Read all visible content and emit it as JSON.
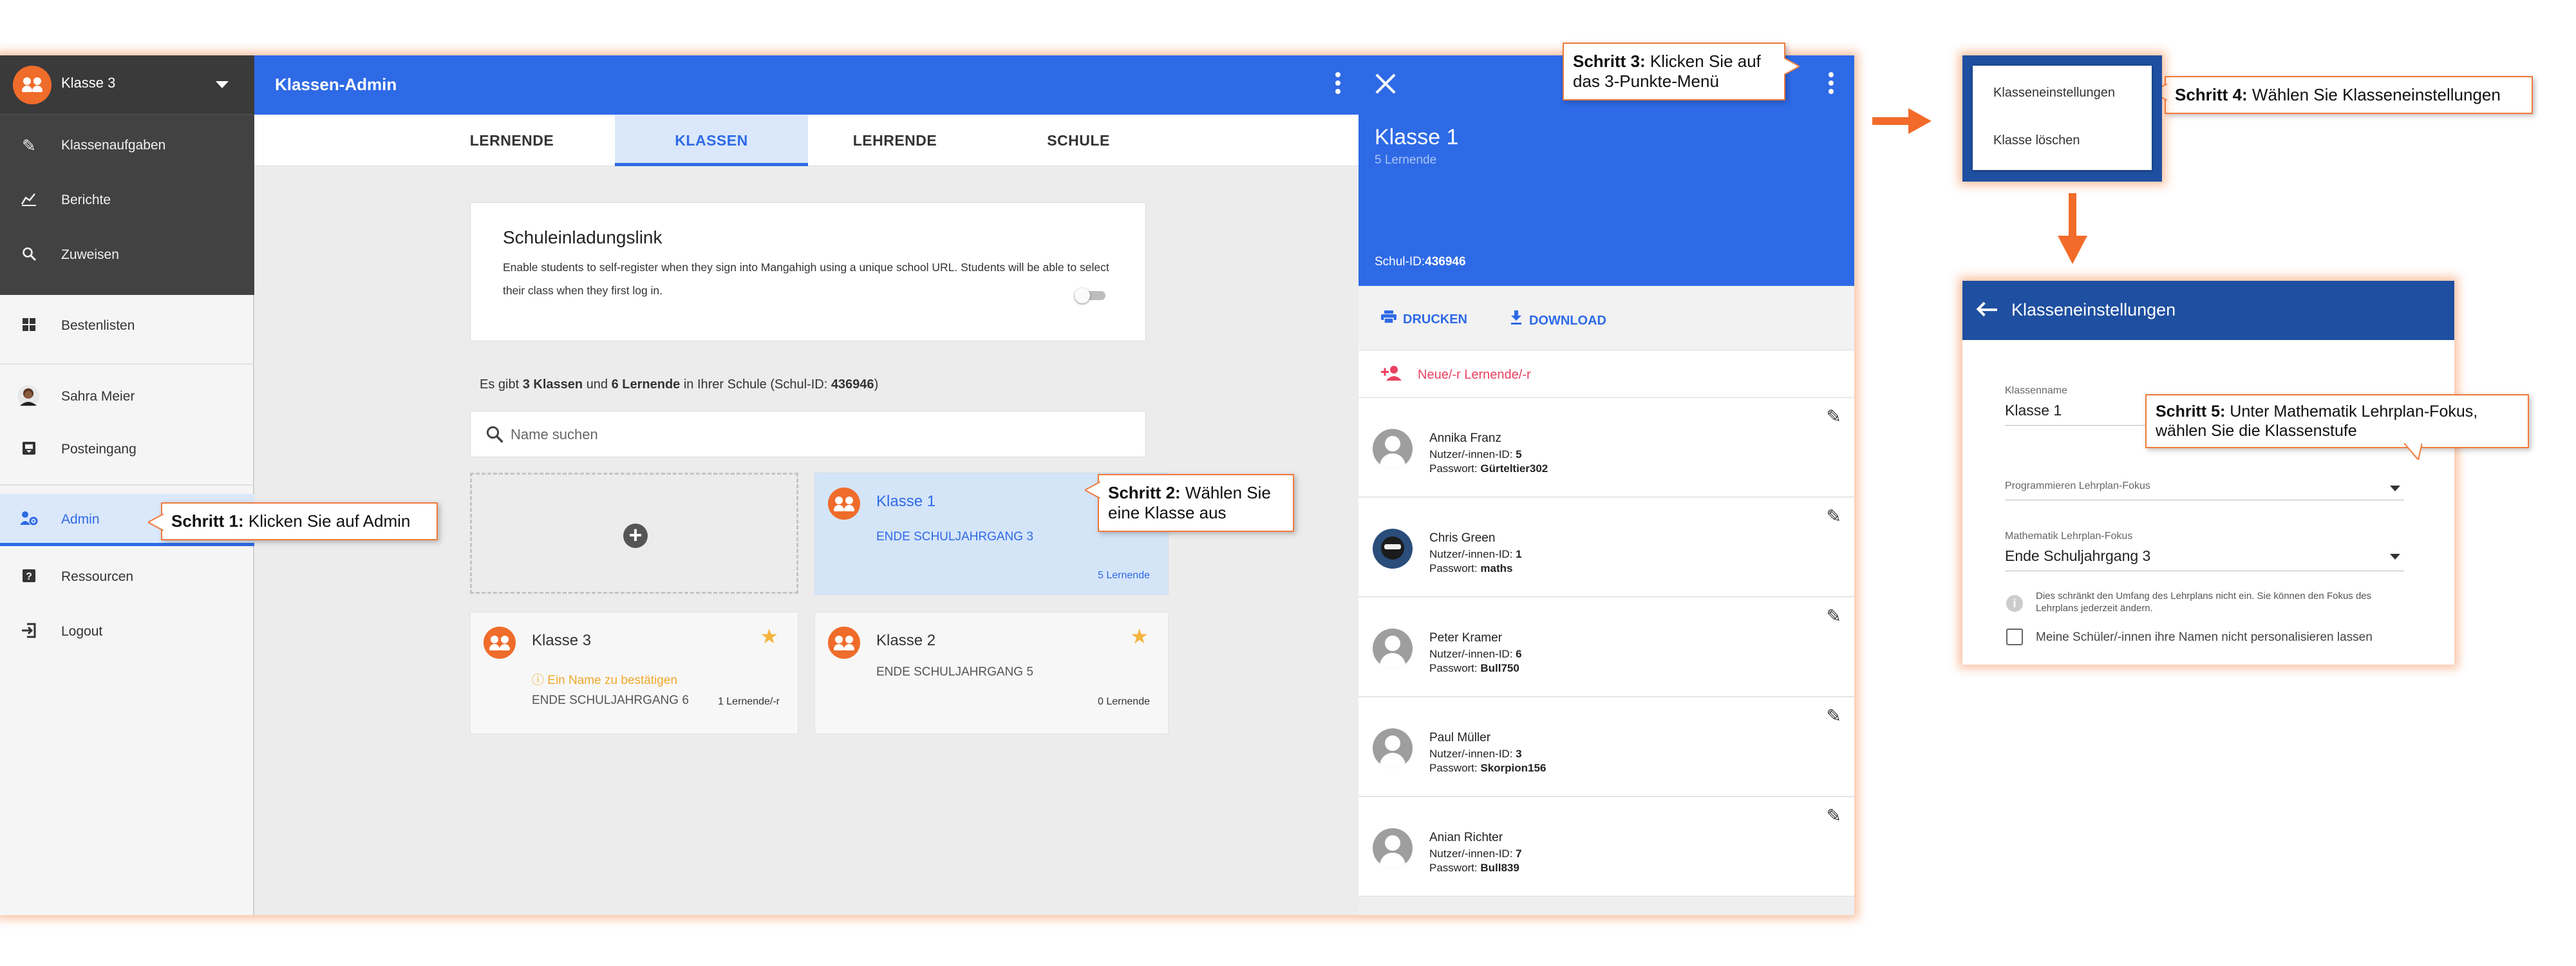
{
  "sidebar": {
    "class_selector": "Klasse 3",
    "items": [
      {
        "label": "Klassenaufgaben",
        "icon": "edit-note-icon"
      },
      {
        "label": "Berichte",
        "icon": "bar-chart-icon"
      },
      {
        "label": "Zuweisen",
        "icon": "search-icon"
      },
      {
        "label": "Bestenlisten",
        "icon": "grid-icon"
      },
      {
        "label": "Sahra Meier",
        "icon": "user-avatar"
      },
      {
        "label": "Posteingang",
        "icon": "inbox-icon"
      },
      {
        "label": "Admin",
        "icon": "admin-settings-icon"
      },
      {
        "label": "Ressourcen",
        "icon": "help-icon"
      },
      {
        "label": "Logout",
        "icon": "logout-icon"
      }
    ]
  },
  "topbar": {
    "title": "Klassen-Admin"
  },
  "tabs": [
    "LERNENDE",
    "KLASSEN",
    "LEHRENDE",
    "SCHULE"
  ],
  "invite": {
    "title": "Schuleinladungslink",
    "description": "Enable students to self-register when they sign into Mangahigh using a unique school URL. Students will be able to select their class when they first log in."
  },
  "summary": {
    "prefix": "Es gibt ",
    "classes": "3 Klassen",
    "middle": " und ",
    "learners": "6 Lernende",
    "suffix": " in Ihrer Schule (Schul-ID: ",
    "school_id": "436946",
    "close": ")"
  },
  "search": {
    "placeholder": "Name suchen"
  },
  "classes": [
    {
      "name": "Klasse 1",
      "grade": "ENDE SCHULJAHRGANG 3",
      "count": "5 Lernende",
      "selected": true
    },
    {
      "name": "Klasse 3",
      "warning": "Ein Name zu bestätigen",
      "grade": "ENDE SCHULJAHRGANG 6",
      "count": "1 Lernende/-r",
      "starred": true
    },
    {
      "name": "Klasse 2",
      "grade": "ENDE SCHULJAHRGANG 5",
      "count": "0 Lernende",
      "starred": true
    }
  ],
  "detail": {
    "title": "Klasse 1",
    "subtitle": "5 Lernende",
    "school_id_label": "Schul-ID:",
    "school_id": "436946",
    "print_label": "DRUCKEN",
    "download_label": "DOWNLOAD",
    "new_learner_label": "Neue/-r Lernende/-r",
    "id_label": "Nutzer/-innen-ID:",
    "pw_label": "Passwort:",
    "learners": [
      {
        "name": "Annika Franz",
        "id": "5",
        "password": "Gürteltier302"
      },
      {
        "name": "Chris Green",
        "id": "1",
        "password": "maths"
      },
      {
        "name": "Peter Kramer",
        "id": "6",
        "password": "Bull750"
      },
      {
        "name": "Paul Müller",
        "id": "3",
        "password": "Skorpion156"
      },
      {
        "name": "Anian Richter",
        "id": "7",
        "password": "Bull839"
      }
    ]
  },
  "menu": {
    "items": [
      "Klasseneinstellungen",
      "Klasse löschen"
    ]
  },
  "settings": {
    "title": "Klasseneinstellungen",
    "name_label": "Klassenname",
    "name_value": "Klasse 1",
    "prog_label": "Programmieren Lehrplan-Fokus",
    "math_label": "Mathematik Lehrplan-Fokus",
    "math_value": "Ende Schuljahrgang 3",
    "info": "Dies schränkt den Umfang des Lehrplans nicht ein. Sie können den Fokus des Lehrplans jederzeit ändern.",
    "checkbox": "Meine Schüler/-innen ihre Namen nicht personalisieren lassen"
  },
  "callouts": {
    "s1_bold": "Schritt 1:",
    "s1_text": " Klicken Sie auf Admin",
    "s2_bold": "Schritt 2:",
    "s2_text": " Wählen Sie eine Klasse aus",
    "s3_bold": "Schritt 3:",
    "s3_text": " Klicken Sie auf das 3-Punkte-Menü",
    "s4_bold": "Schritt 4:",
    "s4_text": " Wählen Sie Klasseneinstellungen",
    "s5_bold": "Schritt 5:",
    "s5_text": " Unter Mathematik Lehrplan-Fokus, wählen Sie die Klassenstufe"
  },
  "colors": {
    "accent": "#2e6ae6",
    "dark_blue": "#1f4fa0",
    "orange": "#ef6c2a",
    "callout_border": "#f07a3c",
    "star": "#f4b53f",
    "warning": "#f0a82a",
    "new_learner": "#e94060"
  }
}
